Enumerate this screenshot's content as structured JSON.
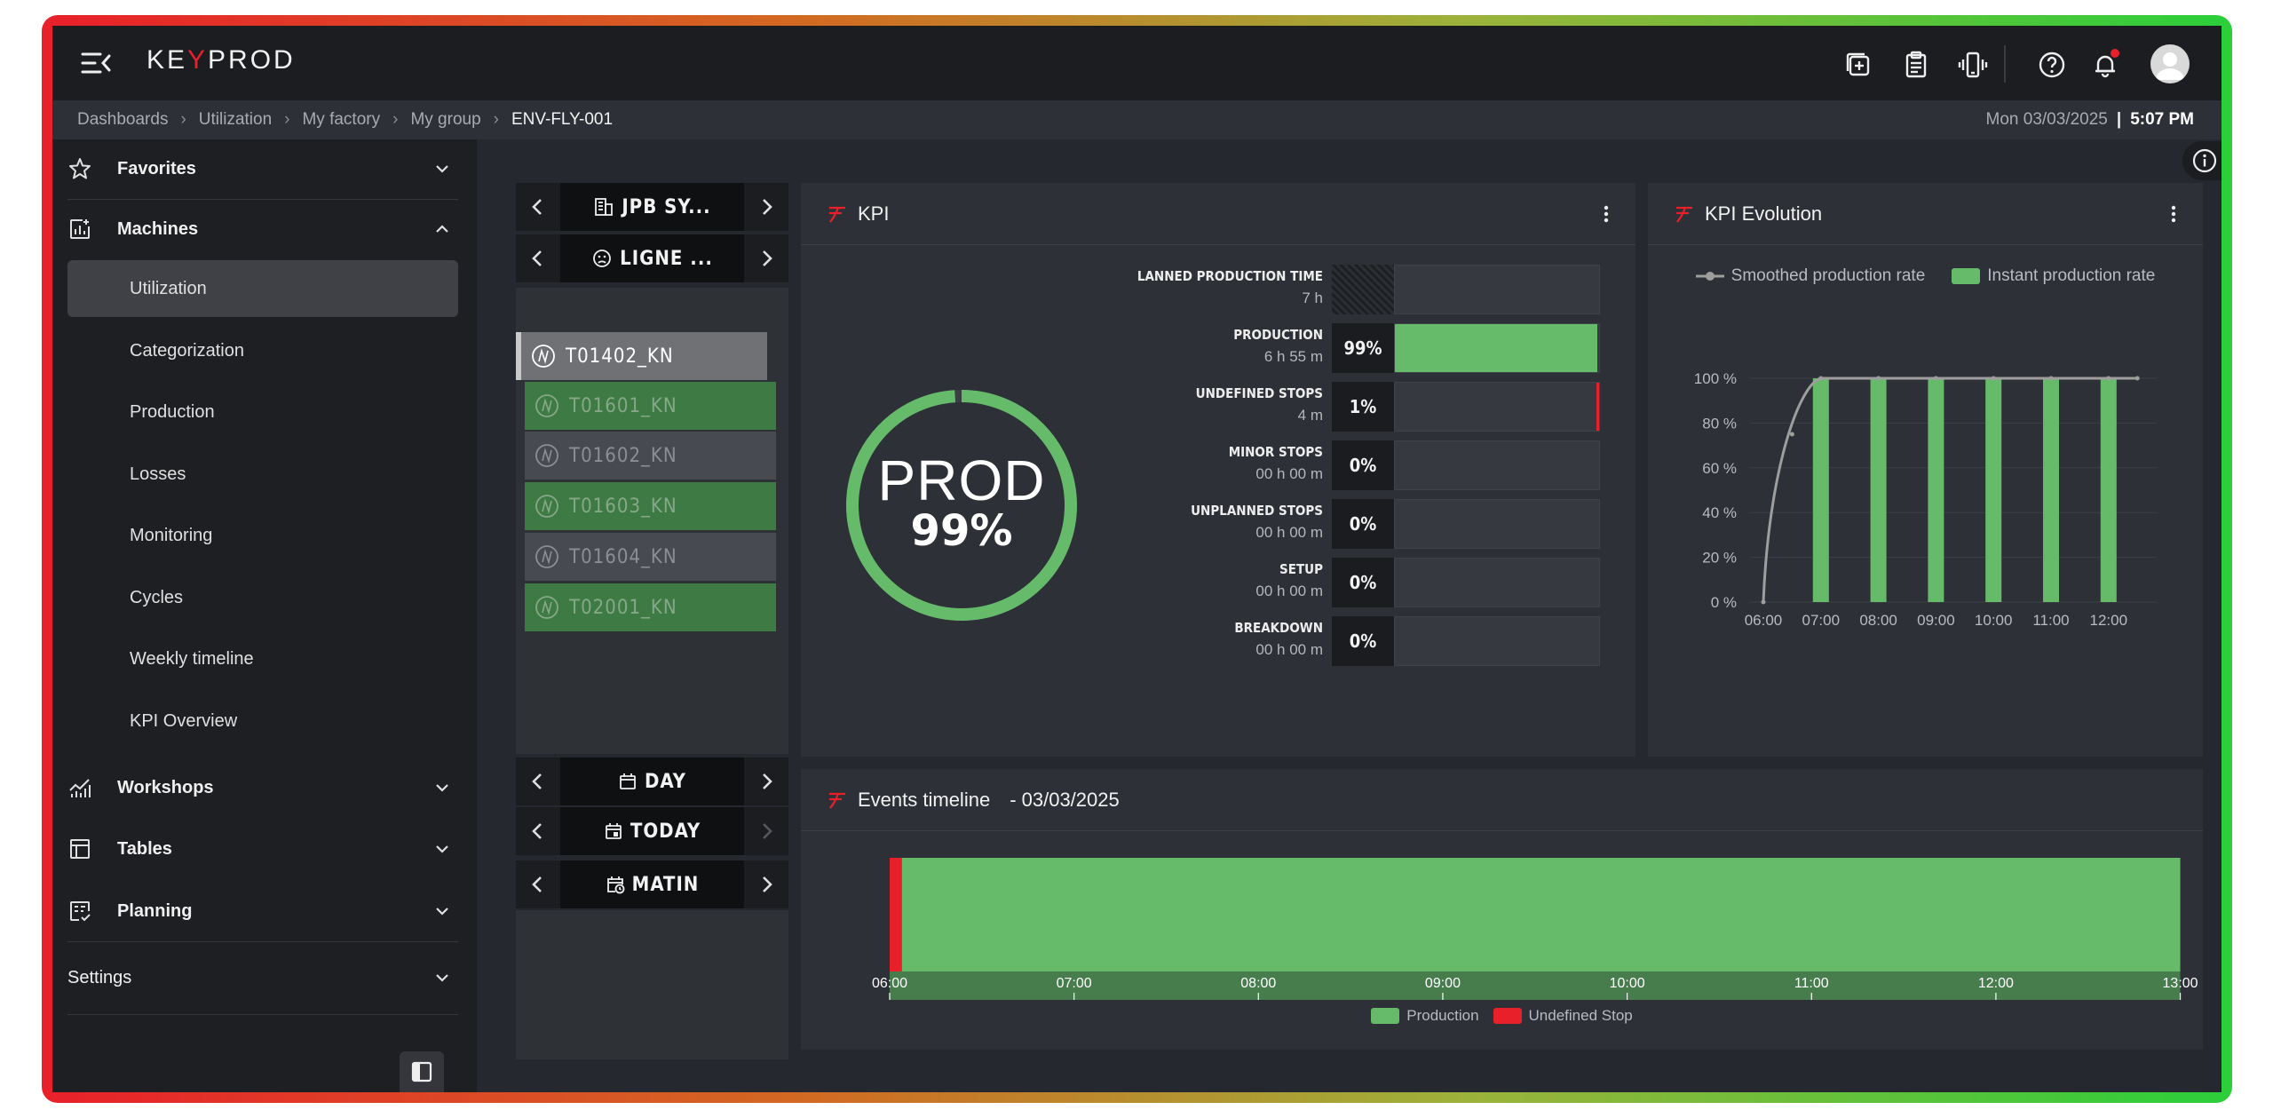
{
  "app": {
    "logo": {
      "left": "KE",
      "mark": "Y",
      "right": "PROD"
    }
  },
  "breadcrumb": {
    "items": [
      "Dashboards",
      "Utilization",
      "My factory",
      "My group"
    ],
    "current": "ENV-FLY-001",
    "separator": "›"
  },
  "datetime": {
    "date": "Mon 03/03/2025",
    "separator": "|",
    "time": "5:07 PM"
  },
  "sidebar": {
    "favorites": "Favorites",
    "machines": "Machines",
    "machine_items": [
      "Utilization",
      "Categorization",
      "Production",
      "Losses",
      "Monitoring",
      "Cycles",
      "Weekly timeline",
      "KPI Overview"
    ],
    "workshops": "Workshops",
    "tables": "Tables",
    "planning": "Planning",
    "settings": "Settings"
  },
  "filters": {
    "site": "JPB SY...",
    "line": "LIGNE ...",
    "period": "DAY",
    "day": "TODAY",
    "shift": "MATIN",
    "machines": [
      {
        "name": "T01402_KN",
        "state": "selected"
      },
      {
        "name": "T01601_KN",
        "state": "production"
      },
      {
        "name": "T01602_KN",
        "state": "idle"
      },
      {
        "name": "T01603_KN",
        "state": "production"
      },
      {
        "name": "T01604_KN",
        "state": "idle"
      },
      {
        "name": "T02001_KN",
        "state": "production"
      }
    ]
  },
  "kpi": {
    "title": "KPI",
    "main_label": "PROD",
    "main_value": "99%",
    "main_fraction": 0.99,
    "rows": [
      {
        "name": "LANNED PRODUCTION TIME",
        "duration": "7 h",
        "percent": "",
        "fill": 0,
        "kind": "planned"
      },
      {
        "name": "PRODUCTION",
        "duration": "6 h 55 m",
        "percent": "99%",
        "fill": 0.99,
        "kind": "production"
      },
      {
        "name": "UNDEFINED STOPS",
        "duration": "4 m",
        "percent": "1%",
        "fill": 0.01,
        "kind": "undefined"
      },
      {
        "name": "MINOR STOPS",
        "duration": "00 h 00 m",
        "percent": "0%",
        "fill": 0,
        "kind": "none"
      },
      {
        "name": "UNPLANNED STOPS",
        "duration": "00 h 00 m",
        "percent": "0%",
        "fill": 0,
        "kind": "none"
      },
      {
        "name": "SETUP",
        "duration": "00 h 00 m",
        "percent": "0%",
        "fill": 0,
        "kind": "none"
      },
      {
        "name": "BREAKDOWN",
        "duration": "00 h 00 m",
        "percent": "0%",
        "fill": 0,
        "kind": "none"
      }
    ]
  },
  "kpi_evolution": {
    "title": "KPI Evolution",
    "legend": {
      "smoothed": "Smoothed production rate",
      "instant": "Instant production rate"
    }
  },
  "events": {
    "title": "Events timeline",
    "date_suffix": "- 03/03/2025",
    "legend": {
      "production": "Production",
      "undefined": "Undefined Stop"
    },
    "segments": [
      {
        "type": "undefined",
        "start": "06:00",
        "end": "06:04"
      },
      {
        "type": "production",
        "start": "06:04",
        "end": "13:00"
      }
    ],
    "ticks": [
      "06:00",
      "07:00",
      "08:00",
      "09:00",
      "10:00",
      "11:00",
      "12:00",
      "13:00"
    ]
  },
  "colors": {
    "production": "#66bb6a",
    "undefined": "#e8202a",
    "smoothed": "#9e9e9e",
    "brand": "#e8202a"
  },
  "chart_data": {
    "type": "bar",
    "categories": [
      "06:00",
      "07:00",
      "08:00",
      "09:00",
      "10:00",
      "11:00",
      "12:00"
    ],
    "series": [
      {
        "name": "Instant production rate",
        "type": "bar",
        "x": [
          "07:00",
          "08:00",
          "09:00",
          "10:00",
          "11:00",
          "12:00"
        ],
        "values": [
          100,
          100,
          100,
          100,
          100,
          100
        ]
      },
      {
        "name": "Smoothed production rate",
        "type": "line",
        "x": [
          "06:00",
          "06:30",
          "07:00",
          "08:00",
          "09:00",
          "10:00",
          "11:00",
          "12:00",
          "12:30"
        ],
        "values": [
          0,
          75,
          100,
          100,
          100,
          100,
          100,
          100,
          100
        ]
      }
    ],
    "yticks": [
      "0 %",
      "20 %",
      "40 %",
      "60 %",
      "80 %",
      "100 %"
    ],
    "ylim": [
      0,
      100
    ],
    "title": "KPI Evolution",
    "legend_position": "top",
    "grid": true
  }
}
